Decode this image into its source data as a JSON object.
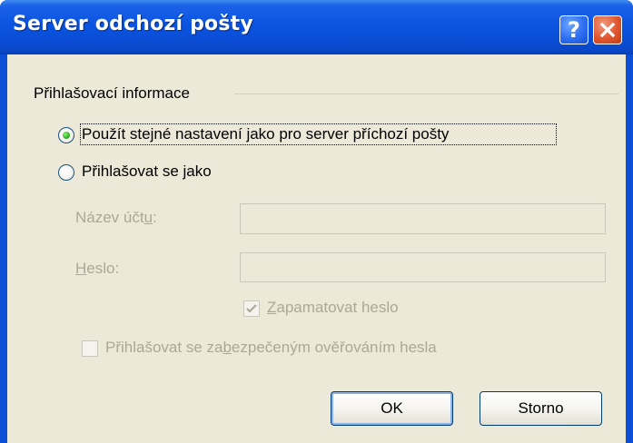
{
  "window": {
    "title": "Server odchozí pošty",
    "help_glyph": "?"
  },
  "group": {
    "label": "Přihlašovací informace"
  },
  "options": {
    "same_settings": {
      "label": "Použít stejné nastavení jako pro server příchozí pošty",
      "selected": true
    },
    "login_as": {
      "label_pre": "Přihlašovat se ",
      "label_key": "j",
      "label_post": "ako",
      "selected": false
    }
  },
  "fields": {
    "account": {
      "label_pre": "Název účt",
      "label_key": "u",
      "label_post": ":",
      "value": "",
      "enabled": false
    },
    "password": {
      "label_key": "H",
      "label_post": "eslo:",
      "value": "",
      "enabled": false
    }
  },
  "checkboxes": {
    "remember": {
      "label_key": "Z",
      "label_post": "apamatovat heslo",
      "checked": true,
      "enabled": false
    },
    "secure": {
      "label_pre": "Přihlašovat se za",
      "label_key": "b",
      "label_post": "ezpečeným ověřováním hesla",
      "checked": false,
      "enabled": false
    }
  },
  "buttons": {
    "ok": "OK",
    "cancel": "Storno"
  },
  "colors": {
    "titlebar": "#0a4ed6",
    "dialog_bg": "#ece9d8",
    "disabled_text": "#aca899",
    "radio_dot": "#33b21f"
  },
  "icons": [
    "help-icon",
    "close-icon",
    "radio-selected-icon",
    "radio-empty-icon",
    "checkmark-icon"
  ]
}
